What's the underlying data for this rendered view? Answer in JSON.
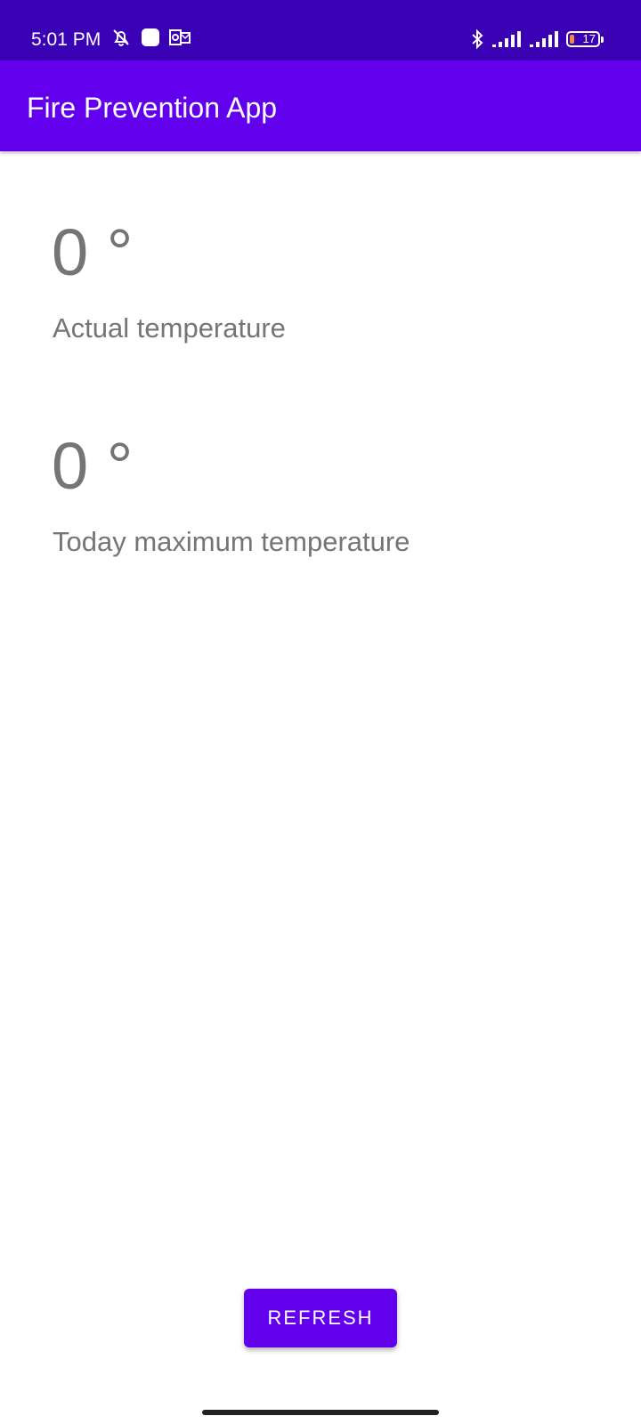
{
  "status_bar": {
    "time": "5:01 PM",
    "battery_level": "17",
    "battery_fraction": 0.17,
    "background_color": "#3a00b4",
    "left_icons": [
      "bell-off-icon",
      "app-square-icon",
      "outlook-icon"
    ],
    "right_icons": [
      "bluetooth-icon",
      "signal-icon",
      "signal-icon",
      "battery-icon"
    ]
  },
  "app_bar": {
    "title": "Fire Prevention App",
    "background_color": "#6200ee"
  },
  "readings": {
    "actual": {
      "value": "0 °",
      "label": "Actual temperature"
    },
    "today_max": {
      "value": "0 °",
      "label": "Today maximum temperature"
    }
  },
  "actions": {
    "refresh_label": "REFRESH",
    "accent_color": "#6200ee"
  }
}
